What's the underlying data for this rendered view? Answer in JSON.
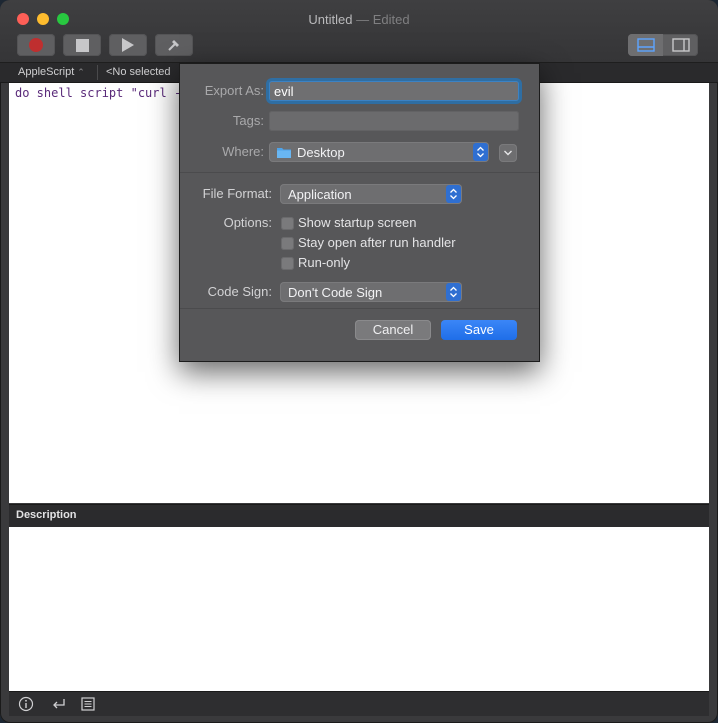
{
  "window": {
    "title": "Untitled",
    "edited_suffix": "— Edited"
  },
  "toolbar": {
    "buttons": [
      {
        "name": "record",
        "icon": "record-icon"
      },
      {
        "name": "stop",
        "icon": "stop-icon"
      },
      {
        "name": "run",
        "icon": "play-icon"
      },
      {
        "name": "compile",
        "icon": "hammer-icon"
      }
    ],
    "view_segment": [
      "editor-view-icon",
      "sidebar-view-icon"
    ]
  },
  "navbar": {
    "language": "AppleScript",
    "element_selector": "<No selected"
  },
  "editor": {
    "code": "do shell script \"curl -"
  },
  "description": {
    "label": "Description"
  },
  "bottom_bar": {
    "icons": [
      "info-icon",
      "return-icon",
      "list-icon"
    ]
  },
  "export_dialog": {
    "export_as_label": "Export As:",
    "export_as_value": "evil",
    "tags_label": "Tags:",
    "tags_value": "",
    "where_label": "Where:",
    "where_value": "Desktop",
    "file_format_label": "File Format:",
    "file_format_value": "Application",
    "options_label": "Options:",
    "options": [
      {
        "label": "Show startup screen",
        "checked": false
      },
      {
        "label": "Stay open after run handler",
        "checked": false
      },
      {
        "label": "Run-only",
        "checked": false
      }
    ],
    "code_sign_label": "Code Sign:",
    "code_sign_value": "Don't Code Sign",
    "cancel_label": "Cancel",
    "save_label": "Save"
  },
  "colors": {
    "accent": "#2f6fd1",
    "close": "#fe5f57",
    "minimize": "#febc2e",
    "maximize": "#28c840",
    "record": "#bf2f2f"
  }
}
